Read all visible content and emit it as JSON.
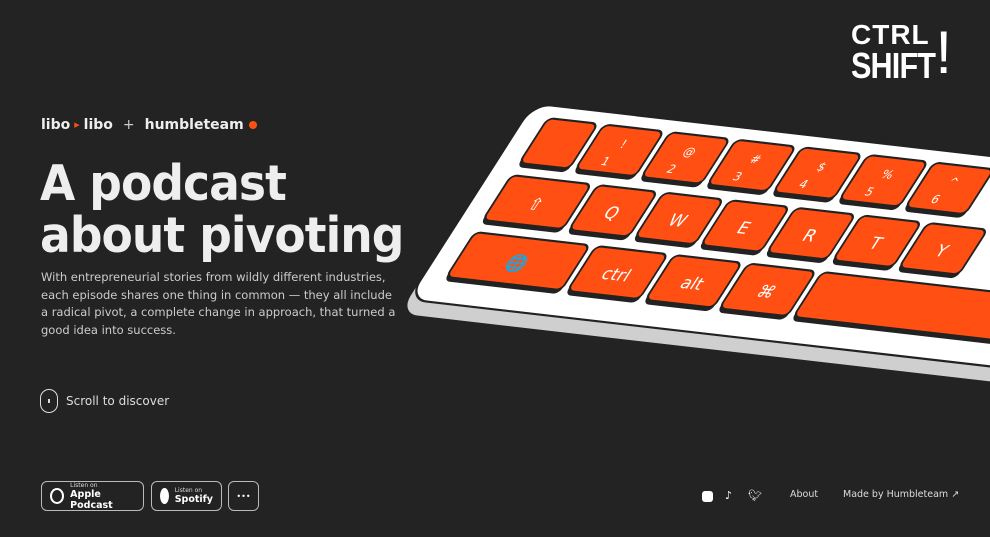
{
  "logo": {
    "line1": "CTRL",
    "line2": "SHIFT",
    "mark": "!"
  },
  "brand": {
    "part1": "libo",
    "part2": "libo",
    "plus": "+",
    "partner": "humbleteam"
  },
  "hero": {
    "title_line1": "A podcast",
    "title_line2": "about pivoting",
    "description": "With entrepreneurial stories from wildly different industries, each episode shares one thing in common — they all include a radical pivot, a complete change in approach, that turned a good idea into success."
  },
  "scroll": {
    "label": "Scroll to discover",
    "icon": "mouse-icon"
  },
  "listen": [
    {
      "small": "Listen on",
      "big": "Apple Podcast",
      "icon": "apple-podcast-icon"
    },
    {
      "small": "Listen on",
      "big": "Spotify",
      "icon": "spotify-icon"
    }
  ],
  "more_label": "•••",
  "social": [
    {
      "icon": "instagram-icon"
    },
    {
      "icon": "tiktok-icon"
    },
    {
      "icon": "twitter-icon"
    }
  ],
  "footer": {
    "about": "About",
    "made_by": "Made by Humbleteam",
    "external_icon": "external-link-icon"
  },
  "keyboard": {
    "accent": "#ff4f12",
    "row1": [
      {
        "top": "",
        "bottom": ""
      },
      {
        "top": "!",
        "bottom": "1"
      },
      {
        "top": "@",
        "bottom": "2"
      },
      {
        "top": "#",
        "bottom": "3"
      },
      {
        "top": "$",
        "bottom": "4"
      },
      {
        "top": "%",
        "bottom": "5"
      },
      {
        "top": "^",
        "bottom": "6"
      }
    ],
    "row2": [
      "⇧",
      "Q",
      "W",
      "E",
      "R",
      "T",
      "Y"
    ],
    "row3": [
      "🌐",
      "ctrl",
      "alt",
      "⌘",
      ""
    ]
  }
}
